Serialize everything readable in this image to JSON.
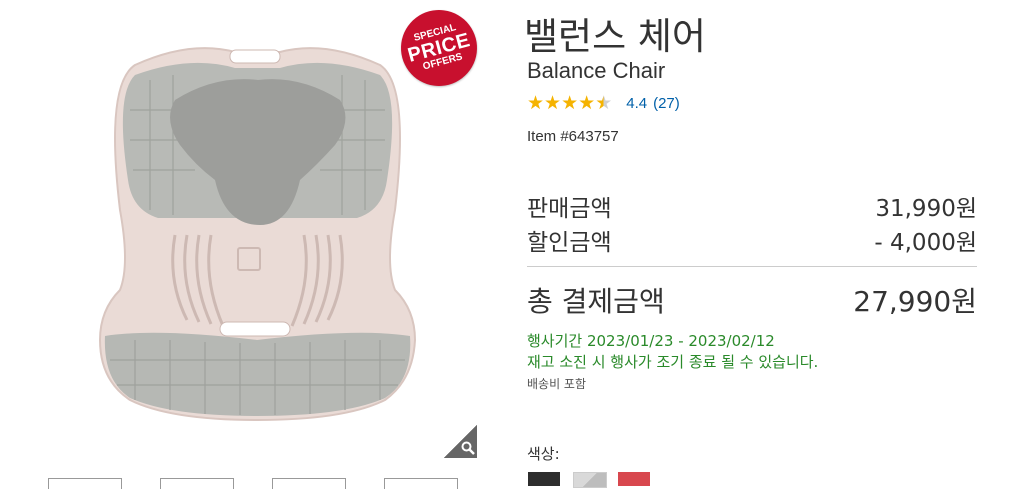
{
  "badge": {
    "line1": "SPECIAL",
    "line2": "PRICE",
    "line3": "OFFERS"
  },
  "product": {
    "title": "밸런스 체어",
    "subtitle": "Balance Chair",
    "rating": {
      "value": "4.4",
      "reviews": "(27)",
      "stars": 4.4
    },
    "item_number": "Item #643757"
  },
  "pricing": {
    "sale_label": "판매금액",
    "sale_value": "31,990원",
    "discount_label": "할인금액",
    "discount_value": "- 4,000원",
    "total_label": "총 결제금액",
    "total_value": "27,990원"
  },
  "promo": {
    "period": "행사기간 2023/01/23 - 2023/02/12",
    "note": "재고 소진 시 행사가 조기 종료 될 수 있습니다."
  },
  "shipping": "배송비 포함",
  "color": {
    "label": "색상:",
    "swatches": [
      "#2d2d2d",
      "#d9d9d9",
      "#d8474e"
    ]
  },
  "icons": {
    "zoom": "magnifier-icon",
    "star": "star-icon"
  },
  "colors": {
    "accent_green": "#2a8a2a",
    "link_blue": "#0060a9",
    "badge_red": "#c8102e",
    "star_gold": "#f5b301"
  }
}
